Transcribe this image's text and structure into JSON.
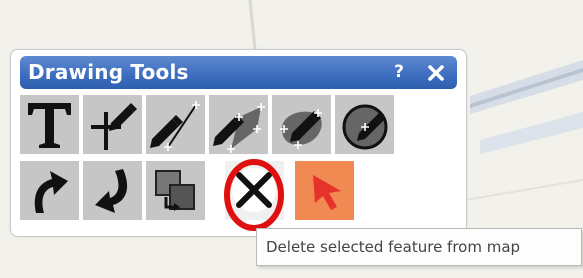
{
  "panel": {
    "title": "Drawing Tools",
    "help_label": "?",
    "close_icon": "close-icon"
  },
  "tools": {
    "row1": [
      "text-tool",
      "point-tool",
      "line-tool",
      "polygon-tool",
      "freehand-polygon-tool",
      "circle-tool"
    ],
    "row2": [
      "undo-tool",
      "redo-tool",
      "move-to-front-tool",
      "delete-feature-tool",
      "select-tool"
    ]
  },
  "tooltip": {
    "text": "Delete selected feature from map"
  },
  "colors": {
    "title_bar": "#3f6fc0",
    "tool_bg": "#c6c6c6",
    "select_tool_bg": "#f08a52",
    "highlight_ring": "#e01010"
  }
}
